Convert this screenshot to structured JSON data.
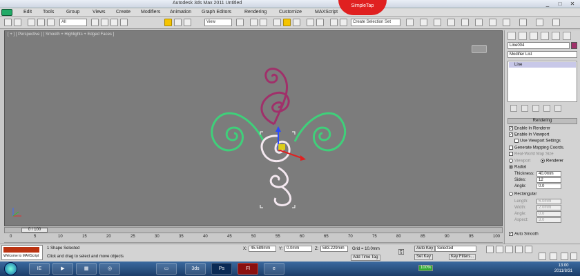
{
  "window": {
    "title": "Autodesk 3ds Max 2011    Untitled",
    "minimize": "_",
    "maximize": "□",
    "close": "✕",
    "overlay_badge": "SimpleTap"
  },
  "menu": [
    "Edit",
    "Tools",
    "Group",
    "Views",
    "Create",
    "Modifiers",
    "Animation",
    "Graph Editors",
    "Rendering",
    "Customize",
    "MAXScript"
  ],
  "toolbar": {
    "selection_filter": "All",
    "ref_coord": "View",
    "named_selection": "Create Selection Set"
  },
  "viewport": {
    "label": "[ + ] [ Perspective ] [ Smooth + Highlights + Edged Faces ]"
  },
  "panel": {
    "object_name": "Line004",
    "object_color": "#a0306a",
    "modifier_list": "Modifier List",
    "stack_item": "Line",
    "rendering_rollout": "Rendering",
    "enable_in_renderer": "Enable In Renderer",
    "enable_in_viewport": "Enable In Viewport",
    "use_viewport_settings": "Use Viewport Settings",
    "generate_mapping": "Generate Mapping Coords.",
    "real_world_map": "Real-World Map Size",
    "viewport_radio": "Viewport",
    "renderer_radio": "Renderer",
    "radial": "Radial",
    "thickness_label": "Thickness:",
    "thickness_value": "40.0mm",
    "sides_label": "Sides:",
    "sides_value": "12",
    "angle_label": "Angle:",
    "angle_value": "0.0",
    "rectangular": "Rectangular",
    "length_label": "Length:",
    "length_value": "6.0mm",
    "width_label": "Width:",
    "width_value": "2.0mm",
    "r_angle_label": "Angle:",
    "r_angle_value": "0.0",
    "aspect_label": "Aspect:",
    "aspect_value": "3.0",
    "auto_smooth": "Auto Smooth"
  },
  "timeline": {
    "frame": "0 / 100",
    "ticks": [
      "0",
      "5",
      "10",
      "15",
      "20",
      "25",
      "30",
      "35",
      "40",
      "45",
      "50",
      "55",
      "60",
      "65",
      "70",
      "75",
      "80",
      "85",
      "90",
      "95",
      "100"
    ]
  },
  "status": {
    "max_label": "Welcome to MAXScript",
    "selection": "1 Shape Selected",
    "prompt": "Click and drag to select and move objects",
    "x_label": "X:",
    "x_value": "45.589mm",
    "y_label": "Y:",
    "y_value": "0.0mm",
    "z_label": "Z:",
    "z_value": "583.229mm",
    "grid": "Grid = 10.0mm",
    "add_time_tag": "Add Time Tag",
    "auto_key": "Auto Key",
    "selected": "Selected",
    "set_key": "Set Key",
    "key_filters": "Key Filters...",
    "zoom_badge": "100%"
  },
  "taskbar": {
    "apps": [
      "IE",
      "▶",
      "▦",
      "◎",
      "▭",
      "3ds",
      "Ps",
      "Fl",
      "e"
    ],
    "time": "13:00",
    "date": "2011/8/31"
  }
}
